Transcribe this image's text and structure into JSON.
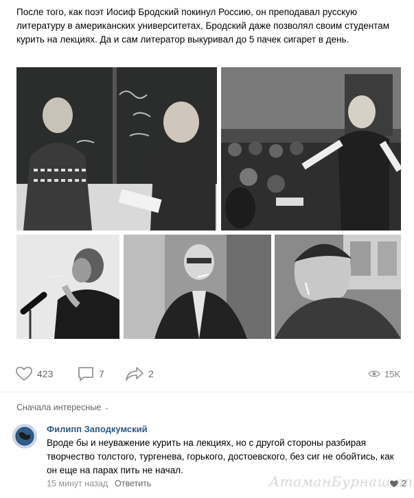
{
  "post": {
    "text": "После того, как поэт Иосиф Бродский покинул Россию, он преподавал русскую литературу в американских университетах, Бродский даже позволял своим студентам курить на лекциях. Да и сам литератор выкуривал до 5 пачек сигарет в день."
  },
  "photos": [
    {
      "icon": "photo-classroom-blackboard"
    },
    {
      "icon": "photo-lecture-hall"
    },
    {
      "icon": "photo-microphone-smoking"
    },
    {
      "icon": "photo-coat-smoking"
    },
    {
      "icon": "photo-portrait-cigarette"
    }
  ],
  "actions": {
    "likes": "423",
    "comments": "7",
    "shares": "2",
    "views": "15K"
  },
  "sort": {
    "label": "Сначала интересные"
  },
  "comment": {
    "author": "Филипп Заподкумский",
    "text": "Вроде бы и неуважение курить на лекциях, но с другой стороны разбирая творчество толстого, тургенева, горького, достоевского, без сиг не обойтись, как он еще на парах пить не начал.",
    "time": "15 минут назад",
    "reply": "Ответить",
    "likes": "2"
  },
  "watermark": "АтаманБурнаш.ant.RU"
}
